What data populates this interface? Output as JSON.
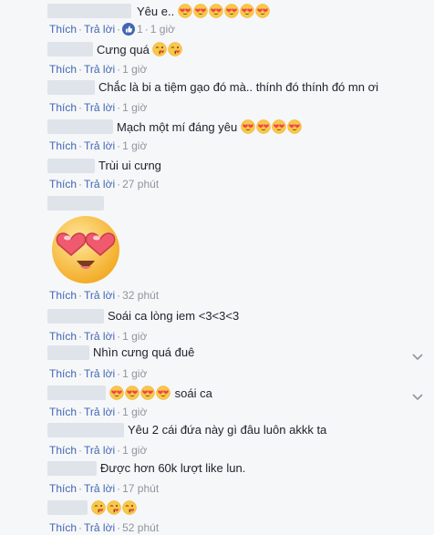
{
  "actions": {
    "like": "Thích",
    "reply": "Trả lời",
    "dot": "·"
  },
  "comments": [
    {
      "name": "",
      "text": "Yêu e..",
      "emoji": "heart-eyes",
      "emoji_count": 6,
      "likes": "1",
      "time": "1 giờ"
    },
    {
      "name": "",
      "text": "Cưng quá",
      "emoji": "kiss",
      "emoji_count": 2,
      "time": "1 giờ"
    },
    {
      "name": "",
      "text": "Chắc là bi a tiệm gạo đó mà.. thính đó thính đó mn ơi",
      "time": "1 giờ"
    },
    {
      "name": "",
      "text": "Mạch một mí đáng yêu",
      "emoji": "heart-eyes",
      "emoji_count": 4,
      "time": "1 giờ"
    },
    {
      "name": "",
      "text": "Trùi ui cưng",
      "time": "27 phút"
    },
    {
      "name": "",
      "text": "",
      "sticker": "heart-eyes-sticker",
      "time": "32 phút"
    },
    {
      "name": "",
      "text": "Soái ca lòng iem <3<3<3",
      "time": "1 giờ"
    },
    {
      "name": "",
      "text": "Nhìn cưng quá đuê",
      "time": "1 giờ"
    },
    {
      "name": "",
      "text": "soái ca",
      "emoji": "heart-eyes",
      "emoji_count": 4,
      "emoji_before": true,
      "time": "1 giờ"
    },
    {
      "name": "",
      "text": "Yêu 2 cái đứa này gì đâu luôn akkk ta",
      "time": "1 giờ"
    },
    {
      "name": "",
      "text": "Được hơn 60k lượt like lun.",
      "time": "17 phút"
    },
    {
      "name": "",
      "text": "",
      "emoji": "kiss",
      "emoji_count": 3,
      "time": "52 phút"
    }
  ],
  "colors": {
    "link": "#4267b2",
    "meta": "#90949c",
    "background": "#f6f7f9"
  }
}
